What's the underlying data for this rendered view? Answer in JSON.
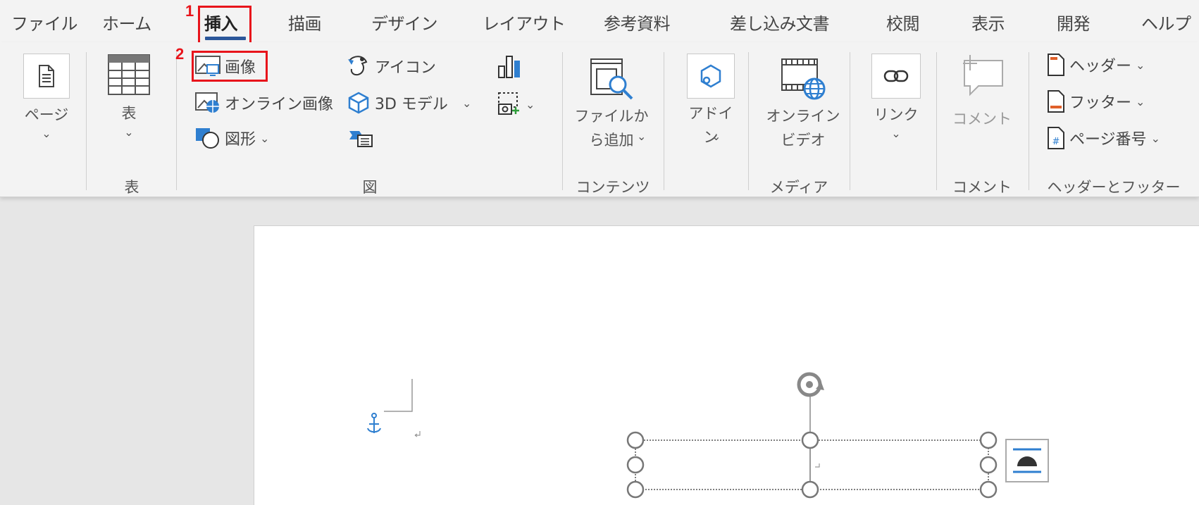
{
  "tabs": [
    "ファイル",
    "ホーム",
    "挿入",
    "描画",
    "デザイン",
    "レイアウト",
    "参考資料",
    "差し込み文書",
    "校閲",
    "表示",
    "開発",
    "ヘルプ"
  ],
  "annotations": {
    "step1": "1",
    "step2": "2"
  },
  "ribbon": {
    "page_btn": "ページ",
    "table_btn": "表",
    "image_btn": "画像",
    "online_image_btn": "オンライン画像",
    "shapes_btn": "図形",
    "icons_btn": "アイコン",
    "model3d_btn": "3D モデル",
    "addfile_btn": "ファイルか\nら追加",
    "addin_btn": "アドイ\nン",
    "online_video_btn": "オンライン\nビデオ",
    "link_btn": "リンク",
    "comment_btn": "コメント",
    "header_btn": "ヘッダー",
    "footer_btn": "フッター",
    "pagenum_btn": "ページ番号",
    "groups": {
      "table": "表",
      "figure": "図",
      "content": "コンテンツ",
      "media": "メディア",
      "comment": "コメント",
      "header_footer": "ヘッダーとフッター"
    }
  },
  "colors": {
    "accent": "#2b579a",
    "highlight": "#e8141b",
    "icon_blue": "#2f7fd0"
  }
}
